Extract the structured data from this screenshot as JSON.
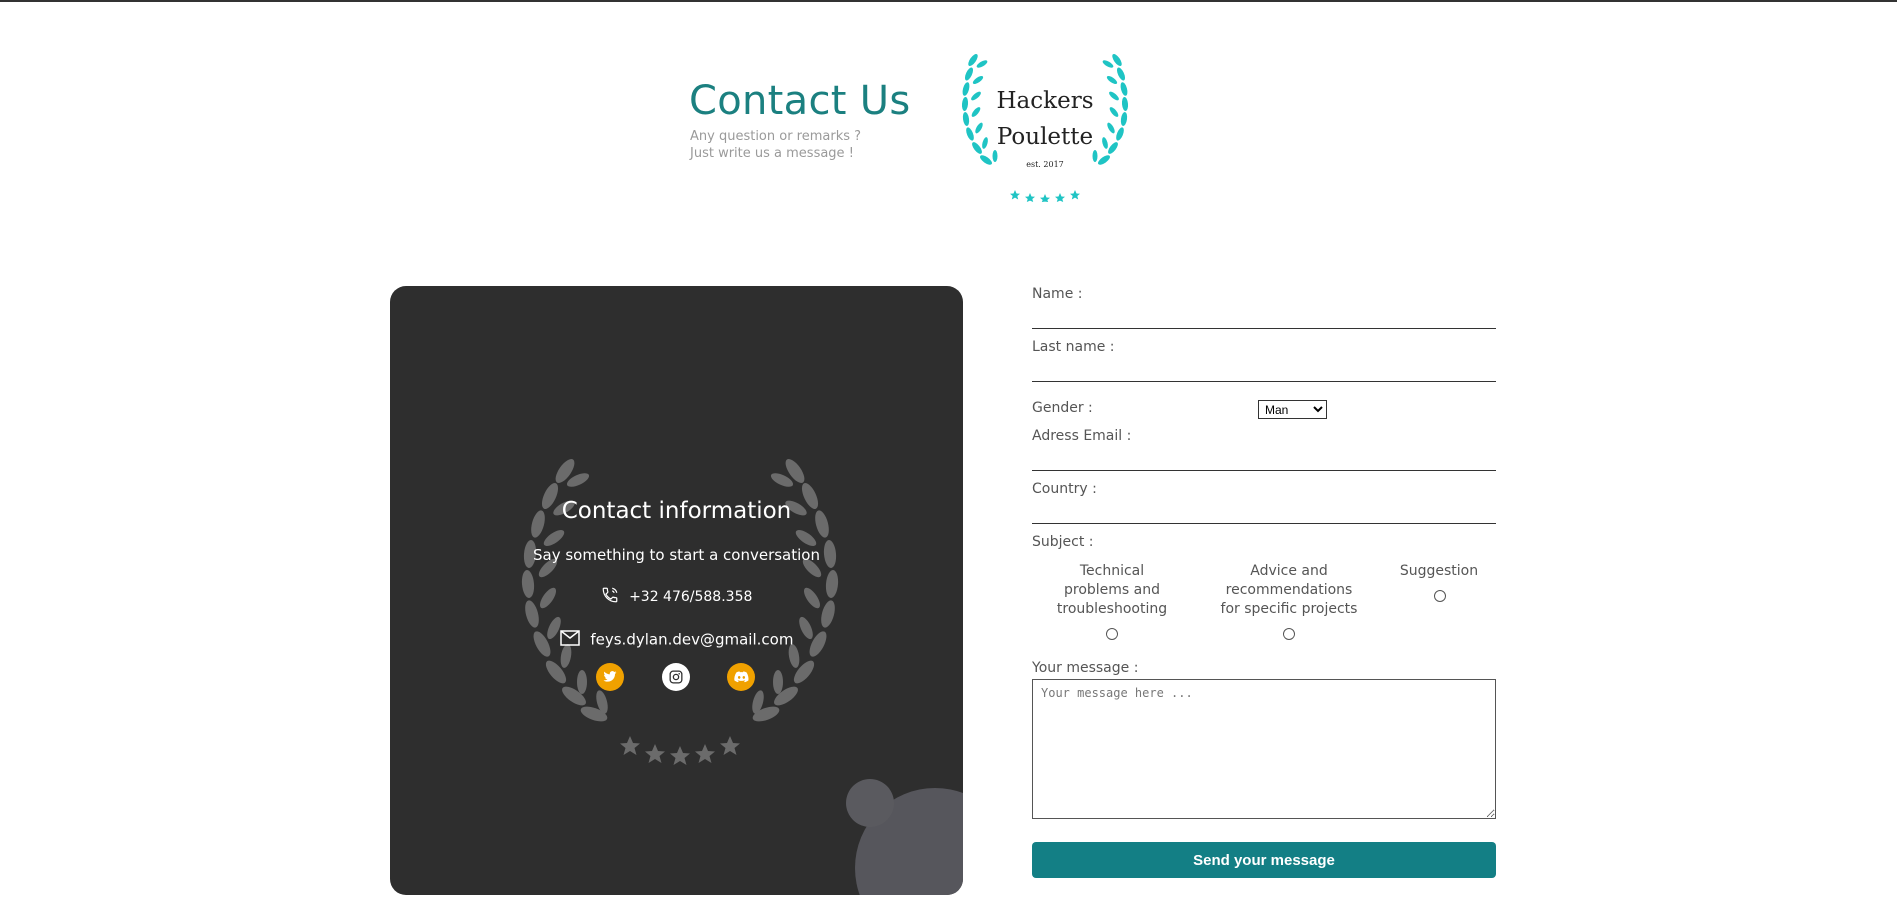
{
  "header": {
    "title": "Contact Us",
    "subtitle_line1": "Any question or remarks ?",
    "subtitle_line2": "Just write us a message !"
  },
  "logo": {
    "line1": "Hackers",
    "line2": "Poulette",
    "line3": "est. 2017",
    "color": "#1fc4c4"
  },
  "contact_card": {
    "title": "Contact information",
    "subtitle": "Say something to start a conversation",
    "phone": "+32 476/588.358",
    "email": "feys.dylan.dev@gmail.com",
    "socials": [
      "twitter-icon",
      "instagram-icon",
      "discord-icon"
    ],
    "background": "#2e2e2e",
    "accent": "#f0a100"
  },
  "form": {
    "name_label": "Name :",
    "lastname_label": "Last name :",
    "gender_label": "Gender :",
    "gender_value": "Man",
    "email_label": "Adress Email :",
    "country_label": "Country :",
    "subject_label": "Subject :",
    "subject_options": [
      "Technical problems and troubleshooting",
      "Advice and recommendations for specific projects",
      "Suggestion"
    ],
    "message_label": "Your message :",
    "message_placeholder": "Your message here ...",
    "submit_label": "Send your message",
    "button_color": "#137f85"
  }
}
